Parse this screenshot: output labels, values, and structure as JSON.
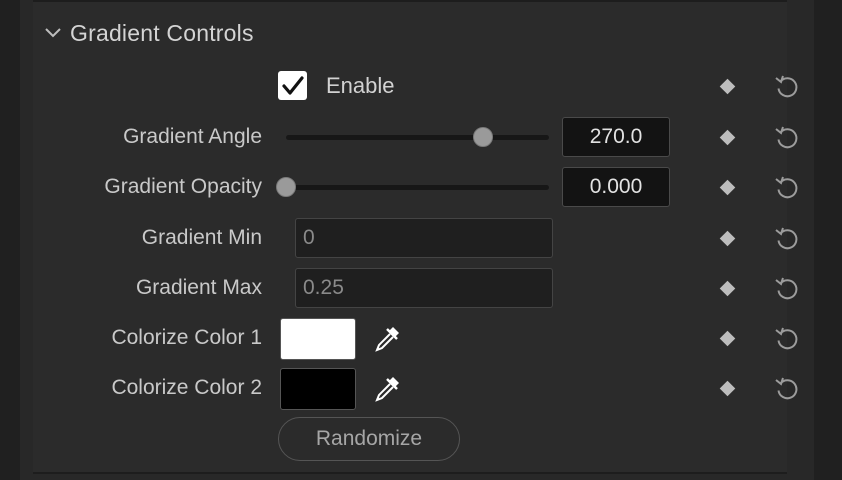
{
  "section": {
    "title": "Gradient Controls"
  },
  "enable": {
    "label": "Enable",
    "checked": true
  },
  "gradient_angle": {
    "label": "Gradient Angle",
    "value": "270.0",
    "slider_fraction": 0.75
  },
  "gradient_opacity": {
    "label": "Gradient Opacity",
    "value": "0.000",
    "slider_fraction": 0.0
  },
  "gradient_min": {
    "label": "Gradient Min",
    "value": "0"
  },
  "gradient_max": {
    "label": "Gradient Max",
    "value": "0.25"
  },
  "colorize_color_1": {
    "label": "Colorize Color 1",
    "color": "#ffffff"
  },
  "colorize_color_2": {
    "label": "Colorize Color 2",
    "color": "#000000"
  },
  "randomize": {
    "label": "Randomize"
  },
  "icons": {
    "section_toggle": "chevron-down-icon",
    "keyframe": "diamond-keyframe-icon",
    "reset": "reset-icon",
    "picker": "eyedropper-icon",
    "check": "checkmark-icon"
  }
}
